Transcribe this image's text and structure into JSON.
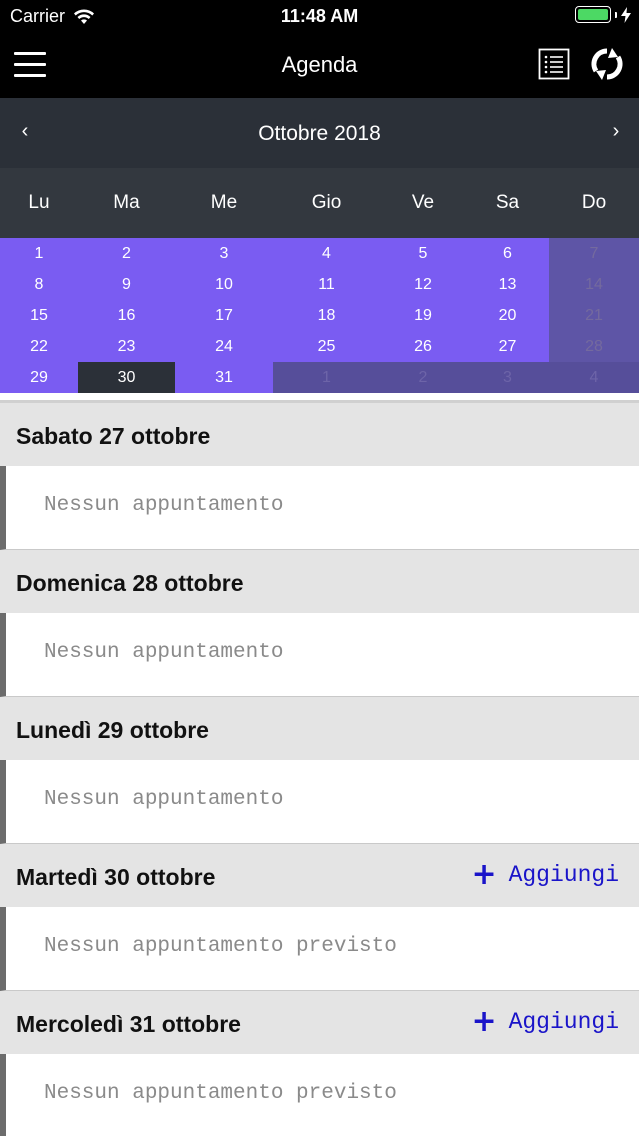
{
  "status_bar": {
    "carrier": "Carrier",
    "time": "11:48 AM",
    "battery_level": 1.0
  },
  "nav": {
    "title": "Agenda",
    "menu_icon": "hamburger-icon",
    "list_icon": "list-view-icon",
    "refresh_icon": "refresh-icon"
  },
  "calendar": {
    "month_label": "Ottobre 2018",
    "prev_label": "‹",
    "next_label": "›",
    "weekdays": [
      "Lu",
      "Ma",
      "Me",
      "Gio",
      "Ve",
      "Sa",
      "Do"
    ],
    "weeks": [
      [
        {
          "d": "1"
        },
        {
          "d": "2"
        },
        {
          "d": "3"
        },
        {
          "d": "4"
        },
        {
          "d": "5"
        },
        {
          "d": "6"
        },
        {
          "d": "7",
          "sunday": true
        }
      ],
      [
        {
          "d": "8"
        },
        {
          "d": "9"
        },
        {
          "d": "10"
        },
        {
          "d": "11"
        },
        {
          "d": "12"
        },
        {
          "d": "13"
        },
        {
          "d": "14",
          "sunday": true
        }
      ],
      [
        {
          "d": "15"
        },
        {
          "d": "16"
        },
        {
          "d": "17"
        },
        {
          "d": "18"
        },
        {
          "d": "19"
        },
        {
          "d": "20"
        },
        {
          "d": "21",
          "sunday": true
        }
      ],
      [
        {
          "d": "22"
        },
        {
          "d": "23"
        },
        {
          "d": "24"
        },
        {
          "d": "25"
        },
        {
          "d": "26"
        },
        {
          "d": "27"
        },
        {
          "d": "28",
          "sunday": true
        }
      ],
      [
        {
          "d": "29"
        },
        {
          "d": "30",
          "today": true
        },
        {
          "d": "31"
        },
        {
          "d": "1",
          "other": true
        },
        {
          "d": "2",
          "other": true
        },
        {
          "d": "3",
          "other": true
        },
        {
          "d": "4",
          "other": true
        }
      ]
    ],
    "colors": {
      "month_bg": "#7a5cf2",
      "today_bg": "#2b3038",
      "header_bg": "#2b3038"
    }
  },
  "agenda": {
    "days": [
      {
        "title": "Sabato 27 ottobre",
        "empty_text": "Nessun appuntamento",
        "add_label": ""
      },
      {
        "title": "Domenica 28 ottobre",
        "empty_text": "Nessun appuntamento",
        "add_label": ""
      },
      {
        "title": "Lunedì 29 ottobre",
        "empty_text": "Nessun appuntamento",
        "add_label": ""
      },
      {
        "title": "Martedì 30 ottobre",
        "empty_text": "Nessun appuntamento previsto",
        "add_label": "Aggiungi"
      },
      {
        "title": "Mercoledì 31 ottobre",
        "empty_text": "Nessun appuntamento previsto",
        "add_label": "Aggiungi"
      }
    ],
    "add_icon": "plus-icon",
    "add_color": "#1a14c9"
  }
}
